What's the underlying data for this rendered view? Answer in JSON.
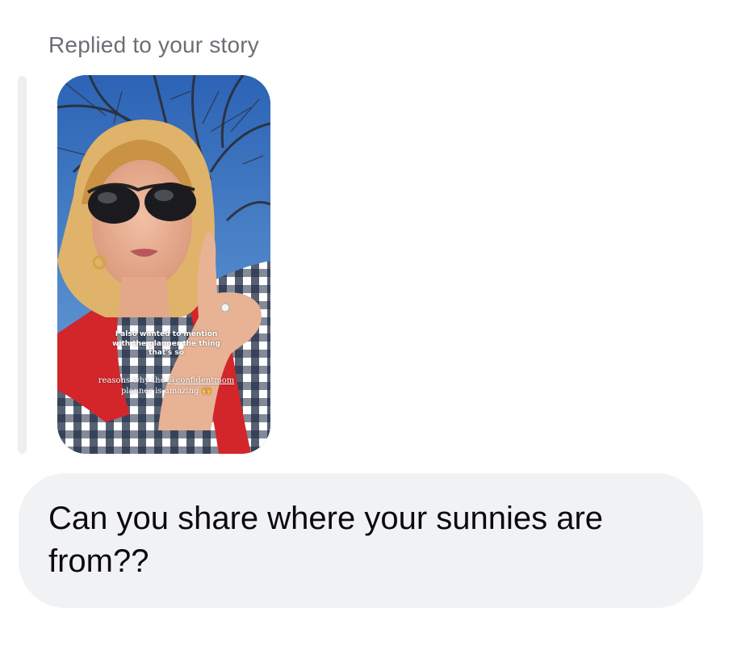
{
  "reply_header": "Replied to your story",
  "story": {
    "caption": "I also wanted to mention with the planner the thing that's so",
    "sub_before": "reasons why the",
    "sub_mention": "@confidentmom",
    "sub_after": "planner is amazing",
    "sub_emoji": "🙌"
  },
  "message": {
    "text": "Can you share where your sunnies are from??"
  },
  "colors": {
    "header_text": "#6b6f75",
    "bubble_bg": "#f1f2f4",
    "message_text": "#0b0b0d"
  }
}
